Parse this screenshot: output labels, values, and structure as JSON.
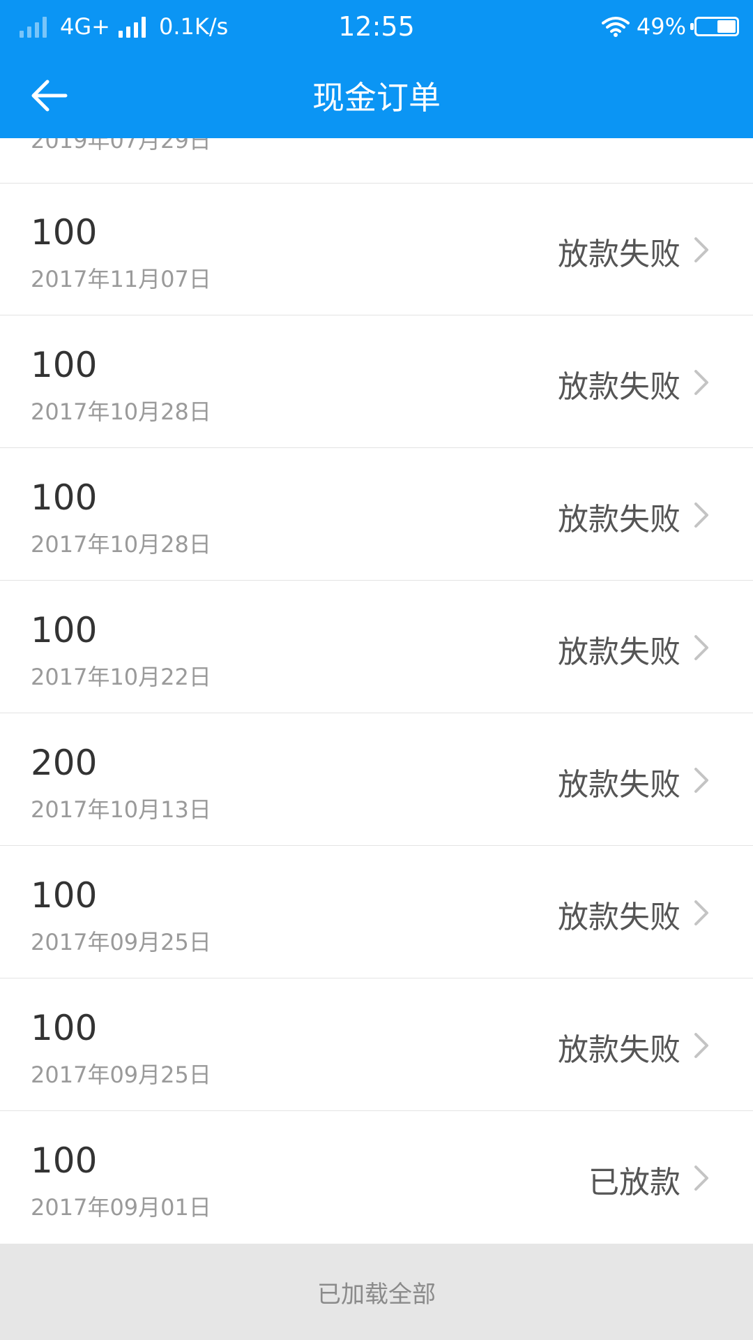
{
  "status_bar": {
    "network": "4G+",
    "speed": "0.1K/s",
    "time": "12:55",
    "battery_text": "49%",
    "battery_level": 0.49
  },
  "header": {
    "title": "现金订单",
    "back_icon": "arrow-left-icon"
  },
  "colors": {
    "header_bg": "#0b95f4",
    "footer_bg": "#e6e6e6"
  },
  "partial_top": {
    "date": "2019年07月29日"
  },
  "orders": [
    {
      "amount": "100",
      "date": "2017年11月07日",
      "status": "放款失败"
    },
    {
      "amount": "100",
      "date": "2017年10月28日",
      "status": "放款失败"
    },
    {
      "amount": "100",
      "date": "2017年10月28日",
      "status": "放款失败"
    },
    {
      "amount": "100",
      "date": "2017年10月22日",
      "status": "放款失败"
    },
    {
      "amount": "200",
      "date": "2017年10月13日",
      "status": "放款失败"
    },
    {
      "amount": "100",
      "date": "2017年09月25日",
      "status": "放款失败"
    },
    {
      "amount": "100",
      "date": "2017年09月25日",
      "status": "放款失败"
    },
    {
      "amount": "100",
      "date": "2017年09月01日",
      "status": "已放款"
    }
  ],
  "footer": {
    "label": "已加载全部"
  }
}
